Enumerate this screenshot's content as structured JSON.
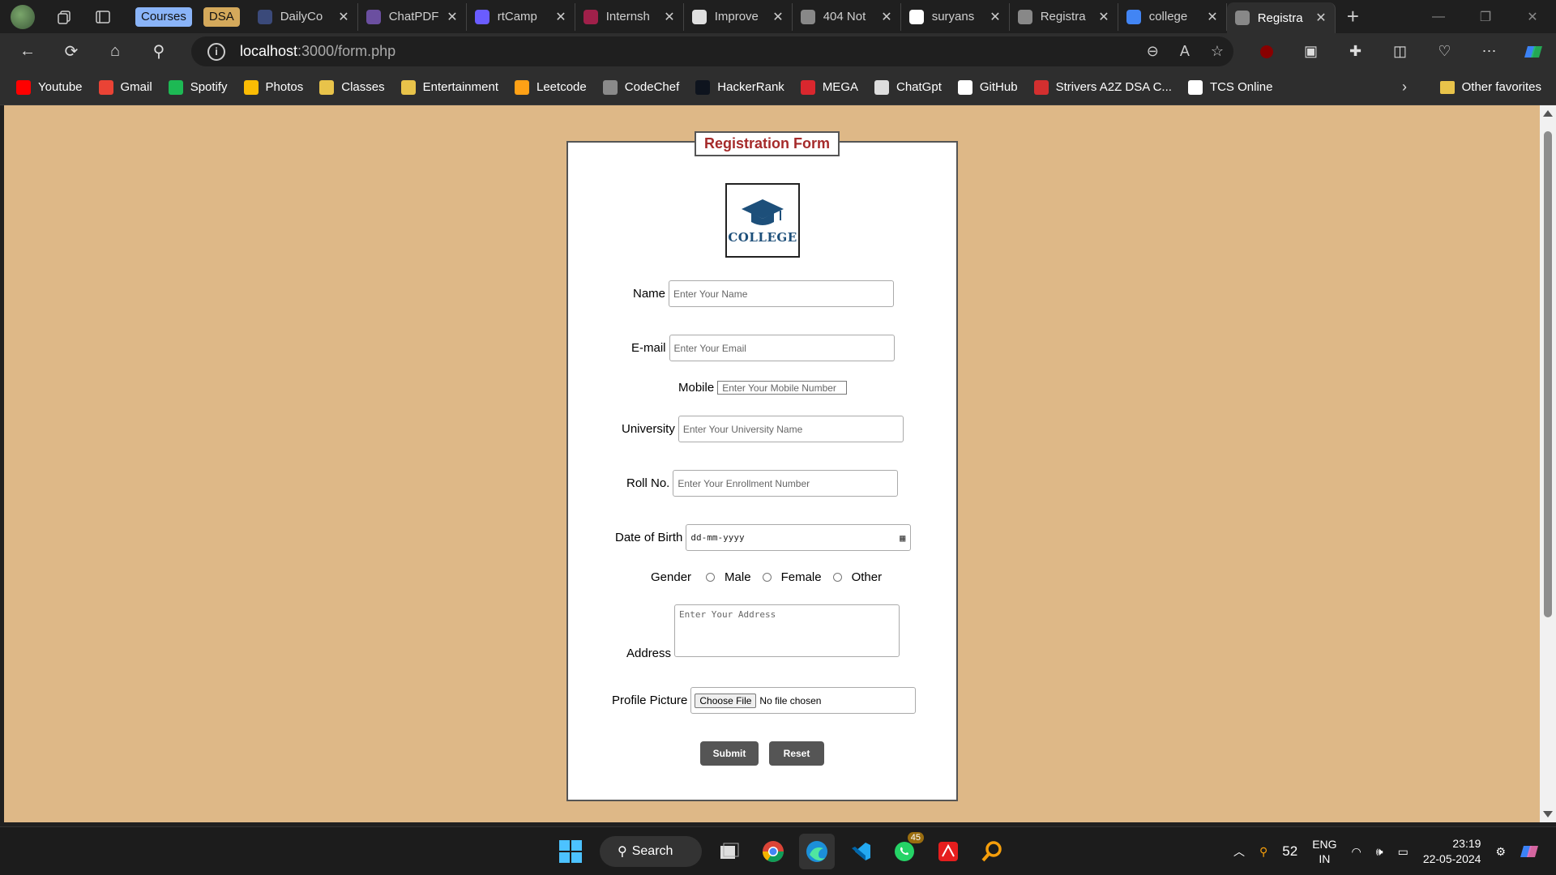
{
  "browser": {
    "tab_groups": [
      {
        "label": "Courses",
        "color": "#8ab4f8"
      },
      {
        "label": "DSA",
        "color": "#d4a95b"
      }
    ],
    "tabs": [
      {
        "label": "DailyCo",
        "icon": "dailycode-icon",
        "color": "#3b4a7a"
      },
      {
        "label": "ChatPDF",
        "icon": "chatpdf-icon",
        "color": "#6b4fa0"
      },
      {
        "label": "rtCamp",
        "icon": "rtcamp-icon",
        "color": "#6a5cff"
      },
      {
        "label": "Internsh",
        "icon": "internshala-icon",
        "color": "#a0204a"
      },
      {
        "label": "Improve",
        "icon": "openai-icon",
        "color": "#e0e0e0"
      },
      {
        "label": "404 Not",
        "icon": "page-icon",
        "color": "#888888"
      },
      {
        "label": "suryans",
        "icon": "github-icon",
        "color": "#ffffff"
      },
      {
        "label": "Registra",
        "icon": "page-icon",
        "color": "#888888"
      },
      {
        "label": "college",
        "icon": "google-icon",
        "color": "#4285f4"
      },
      {
        "label": "Registra",
        "icon": "page-icon",
        "color": "#888888",
        "active": true
      }
    ],
    "url_host": "localhost",
    "url_path": ":3000/form.php",
    "bookmarks": [
      {
        "label": "Youtube",
        "color": "#ff0000"
      },
      {
        "label": "Gmail",
        "color": "#ea4335"
      },
      {
        "label": "Spotify",
        "color": "#1db954"
      },
      {
        "label": "Photos",
        "color": "#fbbc04"
      },
      {
        "label": "Classes",
        "color": "#e8c34a"
      },
      {
        "label": "Entertainment",
        "color": "#e8c34a"
      },
      {
        "label": "Leetcode",
        "color": "#ffa116"
      },
      {
        "label": "CodeChef",
        "color": "#8a8a8a"
      },
      {
        "label": "HackerRank",
        "color": "#0e141e"
      },
      {
        "label": "MEGA",
        "color": "#d9272e"
      },
      {
        "label": "ChatGpt",
        "color": "#dddddd"
      },
      {
        "label": "GitHub",
        "color": "#ffffff"
      },
      {
        "label": "Strivers A2Z DSA C...",
        "color": "#d32f2f"
      },
      {
        "label": "TCS Online",
        "color": "#ffffff"
      }
    ],
    "other_favorites": "Other favorites"
  },
  "form": {
    "title": "Registration Form",
    "logo_text": "COLLEGE",
    "name_label": "Name",
    "name_placeholder": "Enter Your Name",
    "email_label": "E-mail",
    "email_placeholder": "Enter Your Email",
    "mobile_label": "Mobile",
    "mobile_placeholder": "Enter Your Mobile Number",
    "university_label": "University",
    "university_placeholder": "Enter Your University Name",
    "roll_label": "Roll No.",
    "roll_placeholder": "Enter Your Enrollment Number",
    "dob_label": "Date of Birth",
    "dob_placeholder": "dd-mm-yyyy",
    "gender_label": "Gender",
    "gender_options": [
      "Male",
      "Female",
      "Other"
    ],
    "address_label": "Address",
    "address_placeholder": "Enter Your Address",
    "picture_label": "Profile Picture",
    "choose_file": "Choose File",
    "no_file": "No file chosen",
    "submit": "Submit",
    "reset": "Reset",
    "accent": "#a52a2a",
    "page_bg": "#deb887"
  },
  "taskbar": {
    "search": "Search",
    "whatsapp_badge": "45",
    "tray_number": "52",
    "lang": "ENG",
    "region": "IN",
    "time": "23:19",
    "date": "22-05-2024"
  }
}
